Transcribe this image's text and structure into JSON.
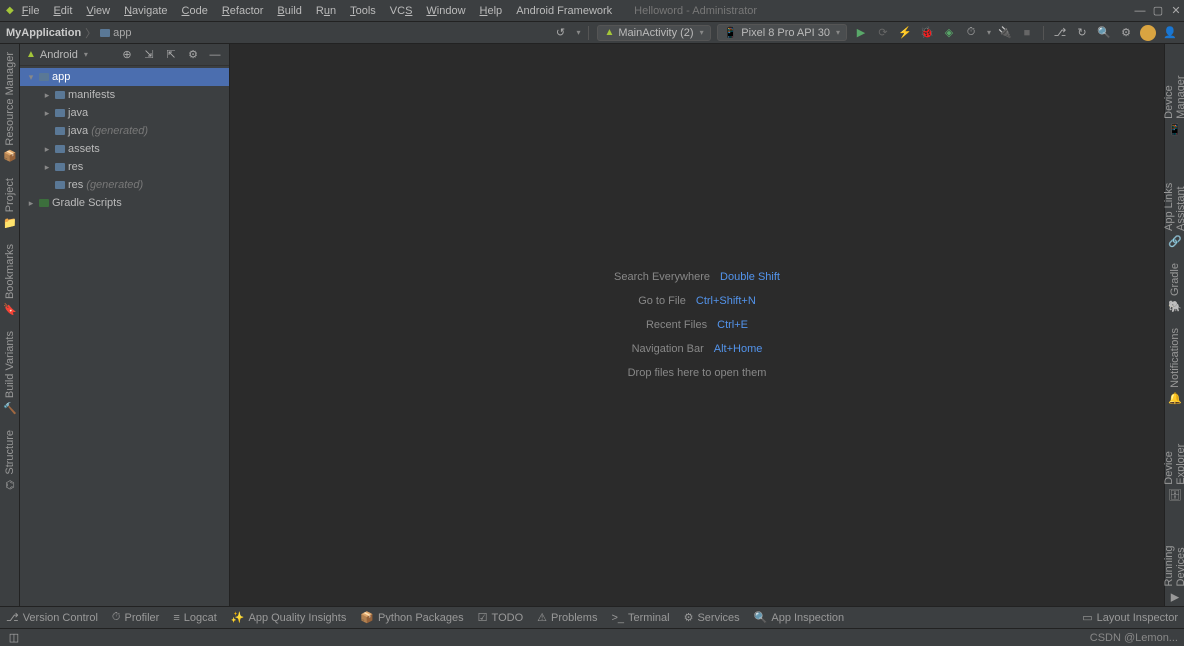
{
  "window": {
    "title": "Helloword - Administrator"
  },
  "menu": [
    "File",
    "Edit",
    "View",
    "Navigate",
    "Code",
    "Refactor",
    "Build",
    "Run",
    "Tools",
    "VCS",
    "Window",
    "Help",
    "Android Framework"
  ],
  "breadcrumb": {
    "project": "MyApplication",
    "module": "app"
  },
  "runConfig": {
    "name": "MainActivity (2)"
  },
  "device": {
    "name": "Pixel 8 Pro API 30"
  },
  "sidebar": {
    "mode": "Android",
    "items": [
      {
        "label": "app",
        "depth": 0,
        "arrow": "▾",
        "sel": true,
        "ico": "folder"
      },
      {
        "label": "manifests",
        "depth": 1,
        "arrow": "▸",
        "ico": "folder"
      },
      {
        "label": "java",
        "depth": 1,
        "arrow": "▸",
        "ico": "folder"
      },
      {
        "label": "java",
        "gen": "(generated)",
        "depth": 1,
        "arrow": "",
        "ico": "folder"
      },
      {
        "label": "assets",
        "depth": 1,
        "arrow": "▸",
        "ico": "folder"
      },
      {
        "label": "res",
        "depth": 1,
        "arrow": "▸",
        "ico": "folder"
      },
      {
        "label": "res",
        "gen": "(generated)",
        "depth": 1,
        "arrow": "",
        "ico": "folder"
      },
      {
        "label": "Gradle Scripts",
        "depth": 0,
        "arrow": "▸",
        "ico": "gradle"
      }
    ]
  },
  "leftRail": [
    {
      "label": "Resource Manager",
      "icon": "📦"
    },
    {
      "label": "Project",
      "icon": "📁"
    },
    {
      "label": "Bookmarks",
      "icon": "🔖"
    },
    {
      "label": "Build Variants",
      "icon": "🔨"
    },
    {
      "label": "Structure",
      "icon": "⌬"
    }
  ],
  "rightRail": [
    {
      "label": "Device Manager",
      "icon": "📱"
    },
    {
      "label": "App Links Assistant",
      "icon": "🔗"
    },
    {
      "label": "Gradle",
      "icon": "🐘"
    },
    {
      "label": "Notifications",
      "icon": "🔔"
    },
    {
      "label": "Device Explorer",
      "icon": "🗄"
    },
    {
      "label": "Running Devices",
      "icon": "▶"
    }
  ],
  "hints": [
    {
      "label": "Search Everywhere",
      "shortcut": "Double Shift"
    },
    {
      "label": "Go to File",
      "shortcut": "Ctrl+Shift+N"
    },
    {
      "label": "Recent Files",
      "shortcut": "Ctrl+E"
    },
    {
      "label": "Navigation Bar",
      "shortcut": "Alt+Home"
    },
    {
      "label": "Drop files here to open them",
      "shortcut": ""
    }
  ],
  "bottom": [
    {
      "label": "Version Control",
      "icon": "⎇"
    },
    {
      "label": "Profiler",
      "icon": "⏱"
    },
    {
      "label": "Logcat",
      "icon": "≡"
    },
    {
      "label": "App Quality Insights",
      "icon": "✨"
    },
    {
      "label": "Python Packages",
      "icon": "📦"
    },
    {
      "label": "TODO",
      "icon": "☑"
    },
    {
      "label": "Problems",
      "icon": "⚠"
    },
    {
      "label": "Terminal",
      "icon": ">_"
    },
    {
      "label": "Services",
      "icon": "⚙"
    },
    {
      "label": "App Inspection",
      "icon": "🔍"
    }
  ],
  "bottomRight": {
    "layoutInspector": "Layout Inspector"
  },
  "status": {
    "watermark": "CSDN @Lemon..."
  }
}
